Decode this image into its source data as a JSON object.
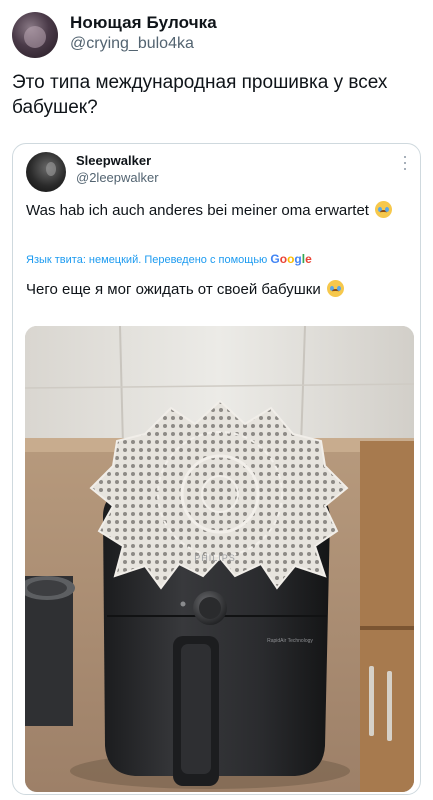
{
  "outer_tweet": {
    "display_name": "Ноющая Булочка",
    "handle": "@crying_bulo4ka",
    "text": "Это типа международная прошивка у всех бабушек?"
  },
  "quoted_tweet": {
    "display_name": "Sleepwalker",
    "handle": "@2leepwalker",
    "original_text": "Was hab ich auch anderes bei meiner oma erwartet",
    "translation_note": "Язык твита: немецкий. Переведено с помощью",
    "translation_provider": "Google",
    "translated_text": "Чего еще я мог ожидать от своей бабушки",
    "emoji": "loudly-crying-face-icon"
  },
  "photo": {
    "brand_label": "PHILIPS",
    "small_label": "RapidAir Technology"
  },
  "colors": {
    "link": "#1d9bf0",
    "secondary_text": "#536471",
    "border": "#cfd9de"
  }
}
